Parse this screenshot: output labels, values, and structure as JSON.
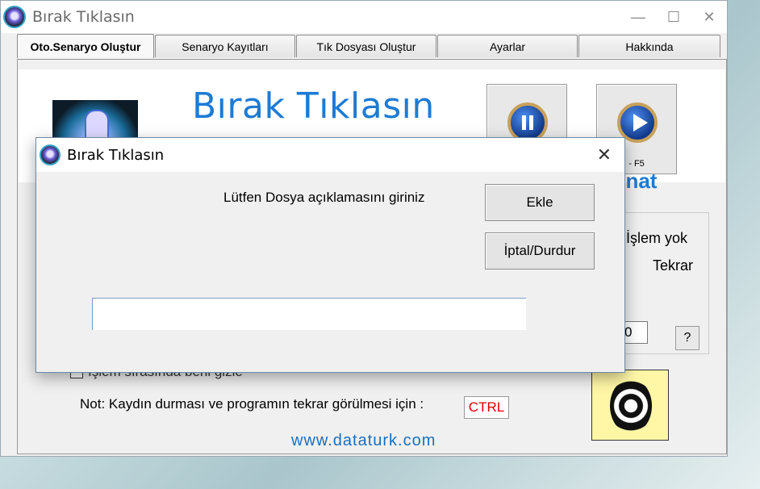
{
  "window": {
    "title": "Bırak Tıklasın",
    "controls": [
      "—",
      "☐",
      "✕"
    ]
  },
  "tabs": [
    {
      "label": "Oto.Senaryo Oluştur",
      "active": true
    },
    {
      "label": "Senaryo Kayıtları"
    },
    {
      "label": "Tık Dosyası Oluştur"
    },
    {
      "label": "Ayarlar"
    },
    {
      "label": "Hakkında"
    }
  ],
  "banner": {
    "title": "Bırak Tıklasın"
  },
  "toolbar": {
    "play_shortcut": "- F5"
  },
  "side": {
    "play_text": "ynat",
    "status": "r İşlem yok",
    "repeat_label": "Tekrar",
    "repeat_value": "0",
    "help": "?"
  },
  "options": {
    "hide_label": "İşlem sırasında beni gizle"
  },
  "note": {
    "text": "Not: Kaydın durması ve programın tekrar görülmesi için :",
    "key": "CTRL"
  },
  "footer": {
    "site": "www.dataturk.com"
  },
  "dialog": {
    "title": "Bırak Tıklasın",
    "prompt": "Lütfen Dosya açıklamasını giriniz",
    "ok_label": "Ekle",
    "cancel_label": "İptal/Durdur",
    "input_value": ""
  }
}
